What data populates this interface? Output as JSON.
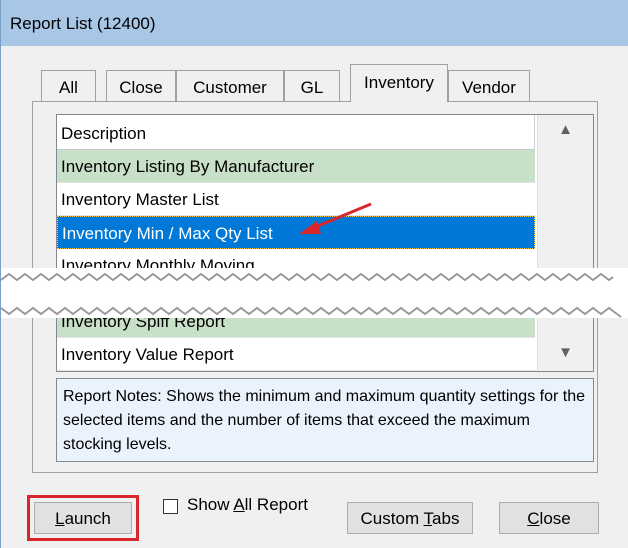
{
  "window": {
    "title": "Report List (12400)"
  },
  "tabs": [
    {
      "label": "All",
      "active": false
    },
    {
      "label": "Close",
      "active": false
    },
    {
      "label": "Customer",
      "active": false
    },
    {
      "label": "GL",
      "active": false
    },
    {
      "label": "Inventory",
      "active": true
    },
    {
      "label": "Vendor",
      "active": false
    }
  ],
  "list": {
    "header": "Description",
    "rows": [
      "Inventory Listing By Manufacturer",
      "Inventory Master List",
      "Inventory Min / Max Qty List",
      "Inventory Monthly Moving",
      "Inventory Spiff Report",
      "Inventory Value Report"
    ],
    "selected_index": 2
  },
  "notes": {
    "text": "Report Notes:  Shows the minimum and maximum quantity settings for the selected items and the number of items that exceed the maximum stocking levels."
  },
  "buttons": {
    "launch": {
      "pre": "",
      "accel": "L",
      "post": "aunch"
    },
    "show_all": {
      "pre": "Show ",
      "accel": "A",
      "post": "ll Report"
    },
    "custom_tabs": {
      "pre": "Custom ",
      "accel": "T",
      "post": "abs"
    },
    "close": {
      "pre": "",
      "accel": "C",
      "post": "lose"
    }
  },
  "colors": {
    "title_bar": "#a8c6e6",
    "selected_row": "#0078d7",
    "shaded_row": "#c8e0c8",
    "notes_bg": "#eaf2fc",
    "callout": "#d9262c"
  }
}
